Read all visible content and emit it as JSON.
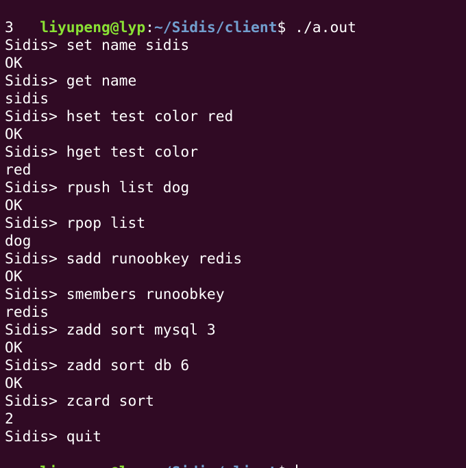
{
  "terminal": {
    "background": "#300a24",
    "colors": {
      "user": "#8ae234",
      "path": "#729fcf",
      "text": "#ffffff"
    },
    "prompt": {
      "user_host": "liyupeng@lyp",
      "separator": ":",
      "path": "~/Sidis/client",
      "dollar": "$"
    },
    "first_command": " ./a.out",
    "lines": [
      "3",
      "Sidis> set name sidis",
      "OK",
      "Sidis> get name",
      "sidis",
      "Sidis> hset test color red",
      "OK",
      "Sidis> hget test color",
      "red",
      "Sidis> rpush list dog",
      "OK",
      "Sidis> rpop list",
      "dog",
      "Sidis> sadd runoobkey redis",
      "OK",
      "Sidis> smembers runoobkey",
      "redis",
      "Sidis> zadd sort mysql 3",
      "OK",
      "Sidis> zadd sort db 6",
      "OK",
      "Sidis> zcard sort",
      "2",
      "Sidis> quit"
    ],
    "last_prompt_trailing": " "
  }
}
